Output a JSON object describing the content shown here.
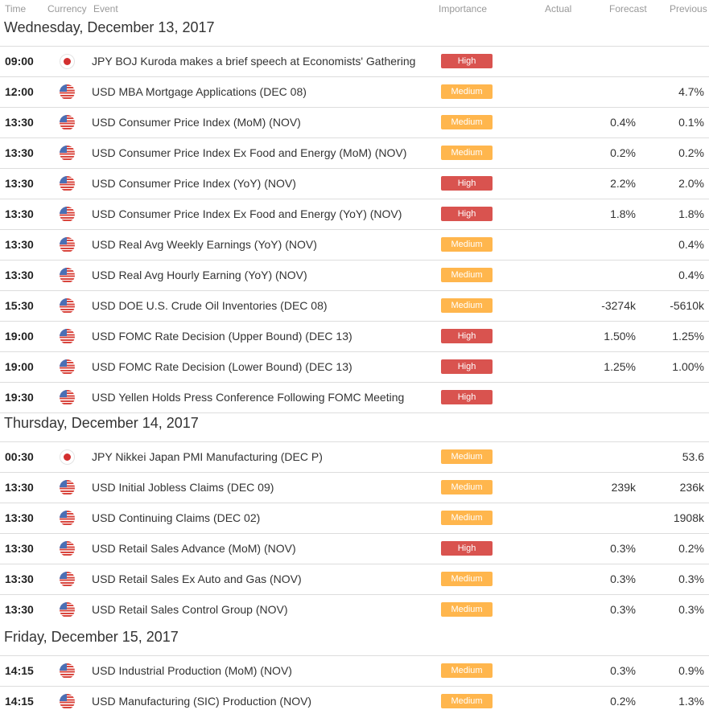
{
  "header": {
    "time": "Time",
    "currency": "Currency",
    "event": "Event",
    "importance": "Importance",
    "actual": "Actual",
    "forecast": "Forecast",
    "previous": "Previous"
  },
  "colors": {
    "high": "#d9534f",
    "medium": "#ffb64d"
  },
  "days": [
    {
      "heading": "Wednesday, December 13, 2017",
      "events": [
        {
          "time": "09:00",
          "flag": "jp-flag-icon",
          "event": "JPY BOJ Kuroda makes a brief speech at Economists' Gathering",
          "importance": "High",
          "actual": "",
          "forecast": "",
          "previous": ""
        },
        {
          "time": "12:00",
          "flag": "us-flag-icon",
          "event": "USD MBA Mortgage Applications (DEC 08)",
          "importance": "Medium",
          "actual": "",
          "forecast": "",
          "previous": "4.7%"
        },
        {
          "time": "13:30",
          "flag": "us-flag-icon",
          "event": "USD Consumer Price Index (MoM) (NOV)",
          "importance": "Medium",
          "actual": "",
          "forecast": "0.4%",
          "previous": "0.1%"
        },
        {
          "time": "13:30",
          "flag": "us-flag-icon",
          "event": "USD Consumer Price Index Ex Food and Energy (MoM) (NOV)",
          "importance": "Medium",
          "actual": "",
          "forecast": "0.2%",
          "previous": "0.2%"
        },
        {
          "time": "13:30",
          "flag": "us-flag-icon",
          "event": "USD Consumer Price Index (YoY) (NOV)",
          "importance": "High",
          "actual": "",
          "forecast": "2.2%",
          "previous": "2.0%"
        },
        {
          "time": "13:30",
          "flag": "us-flag-icon",
          "event": "USD Consumer Price Index Ex Food and Energy (YoY) (NOV)",
          "importance": "High",
          "actual": "",
          "forecast": "1.8%",
          "previous": "1.8%"
        },
        {
          "time": "13:30",
          "flag": "us-flag-icon",
          "event": "USD Real Avg Weekly Earnings (YoY) (NOV)",
          "importance": "Medium",
          "actual": "",
          "forecast": "",
          "previous": "0.4%"
        },
        {
          "time": "13:30",
          "flag": "us-flag-icon",
          "event": "USD Real Avg Hourly Earning (YoY) (NOV)",
          "importance": "Medium",
          "actual": "",
          "forecast": "",
          "previous": "0.4%"
        },
        {
          "time": "15:30",
          "flag": "us-flag-icon",
          "event": "USD DOE U.S. Crude Oil Inventories (DEC 08)",
          "importance": "Medium",
          "actual": "",
          "forecast": "-3274k",
          "previous": "-5610k"
        },
        {
          "time": "19:00",
          "flag": "us-flag-icon",
          "event": "USD FOMC Rate Decision (Upper Bound) (DEC 13)",
          "importance": "High",
          "actual": "",
          "forecast": "1.50%",
          "previous": "1.25%"
        },
        {
          "time": "19:00",
          "flag": "us-flag-icon",
          "event": "USD FOMC Rate Decision (Lower Bound) (DEC 13)",
          "importance": "High",
          "actual": "",
          "forecast": "1.25%",
          "previous": "1.00%"
        },
        {
          "time": "19:30",
          "flag": "us-flag-icon",
          "event": "USD Yellen Holds Press Conference Following FOMC Meeting",
          "importance": "High",
          "actual": "",
          "forecast": "",
          "previous": ""
        }
      ]
    },
    {
      "heading": "Thursday, December 14, 2017",
      "events": [
        {
          "time": "00:30",
          "flag": "jp-flag-icon",
          "event": "JPY Nikkei Japan PMI Manufacturing (DEC P)",
          "importance": "Medium",
          "actual": "",
          "forecast": "",
          "previous": "53.6"
        },
        {
          "time": "13:30",
          "flag": "us-flag-icon",
          "event": "USD Initial Jobless Claims (DEC 09)",
          "importance": "Medium",
          "actual": "",
          "forecast": "239k",
          "previous": "236k"
        },
        {
          "time": "13:30",
          "flag": "us-flag-icon",
          "event": "USD Continuing Claims (DEC 02)",
          "importance": "Medium",
          "actual": "",
          "forecast": "",
          "previous": "1908k"
        },
        {
          "time": "13:30",
          "flag": "us-flag-icon",
          "event": "USD Retail Sales Advance (MoM) (NOV)",
          "importance": "High",
          "actual": "",
          "forecast": "0.3%",
          "previous": "0.2%"
        },
        {
          "time": "13:30",
          "flag": "us-flag-icon",
          "event": "USD Retail Sales Ex Auto and Gas (NOV)",
          "importance": "Medium",
          "actual": "",
          "forecast": "0.3%",
          "previous": "0.3%"
        },
        {
          "time": "13:30",
          "flag": "us-flag-icon",
          "event": "USD Retail Sales Control Group (NOV)",
          "importance": "Medium",
          "actual": "",
          "forecast": "0.3%",
          "previous": "0.3%"
        }
      ]
    },
    {
      "heading": "Friday, December 15, 2017",
      "events": [
        {
          "time": "14:15",
          "flag": "us-flag-icon",
          "event": "USD Industrial Production (MoM) (NOV)",
          "importance": "Medium",
          "actual": "",
          "forecast": "0.3%",
          "previous": "0.9%"
        },
        {
          "time": "14:15",
          "flag": "us-flag-icon",
          "event": "USD Manufacturing (SIC) Production (NOV)",
          "importance": "Medium",
          "actual": "",
          "forecast": "0.2%",
          "previous": "1.3%"
        }
      ]
    }
  ]
}
